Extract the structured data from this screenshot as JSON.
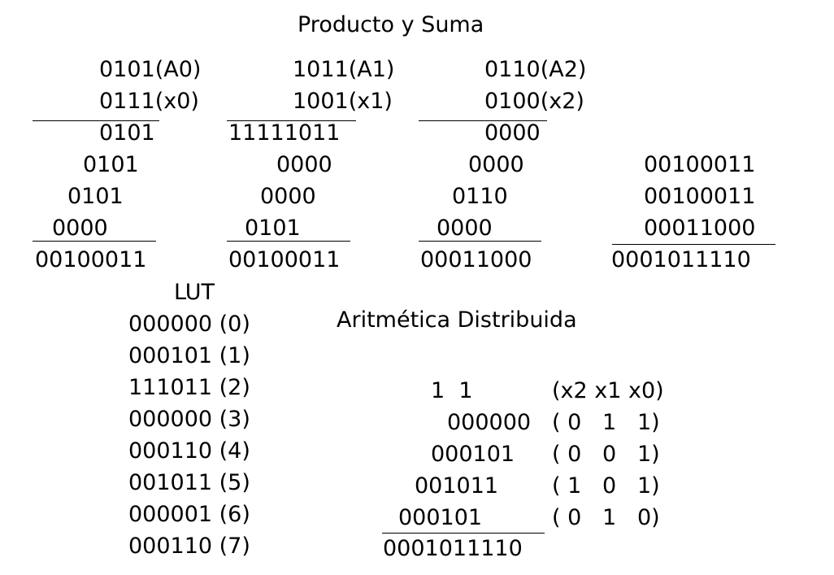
{
  "titles": {
    "producto_suma": "Producto y Suma",
    "lut": "LUT",
    "aritmetica": "Aritmética Distribuida"
  },
  "products": [
    {
      "multiplicand": "0101(A0)",
      "multiplier": "0111(x0)",
      "partials": [
        "0101",
        "0101",
        "0101",
        "0000"
      ],
      "result": "00100011"
    },
    {
      "multiplicand": "1011(A1)",
      "multiplier": "1001(x1)",
      "partials": [
        "11111011",
        "0000",
        "0000",
        "0101"
      ],
      "result": "00100011"
    },
    {
      "multiplicand": "0110(A2)",
      "multiplier": "0100(x2)",
      "partials": [
        "0000",
        "0000",
        "0110",
        "0000"
      ],
      "result": "00011000"
    }
  ],
  "sum": {
    "addends": [
      "00100011",
      "00100011",
      "00011000"
    ],
    "result": "0001011110"
  },
  "lut": [
    "000000 (0)",
    "000101 (1)",
    "111011 (2)",
    "000000 (3)",
    "000110 (4)",
    "001011 (5)",
    "000001 (6)",
    "000110 (7)"
  ],
  "distributed": {
    "header_left": "1  1",
    "header_right": "(x2 x1 x0)",
    "rows": [
      {
        "value": "000000",
        "bits": "( 0   1   1)"
      },
      {
        "value": "000101",
        "bits": "( 0   0   1)"
      },
      {
        "value": "001011",
        "bits": "( 1   0   1)"
      },
      {
        "value": "000101",
        "bits": "( 0   1   0)"
      }
    ],
    "result": "0001011110"
  }
}
